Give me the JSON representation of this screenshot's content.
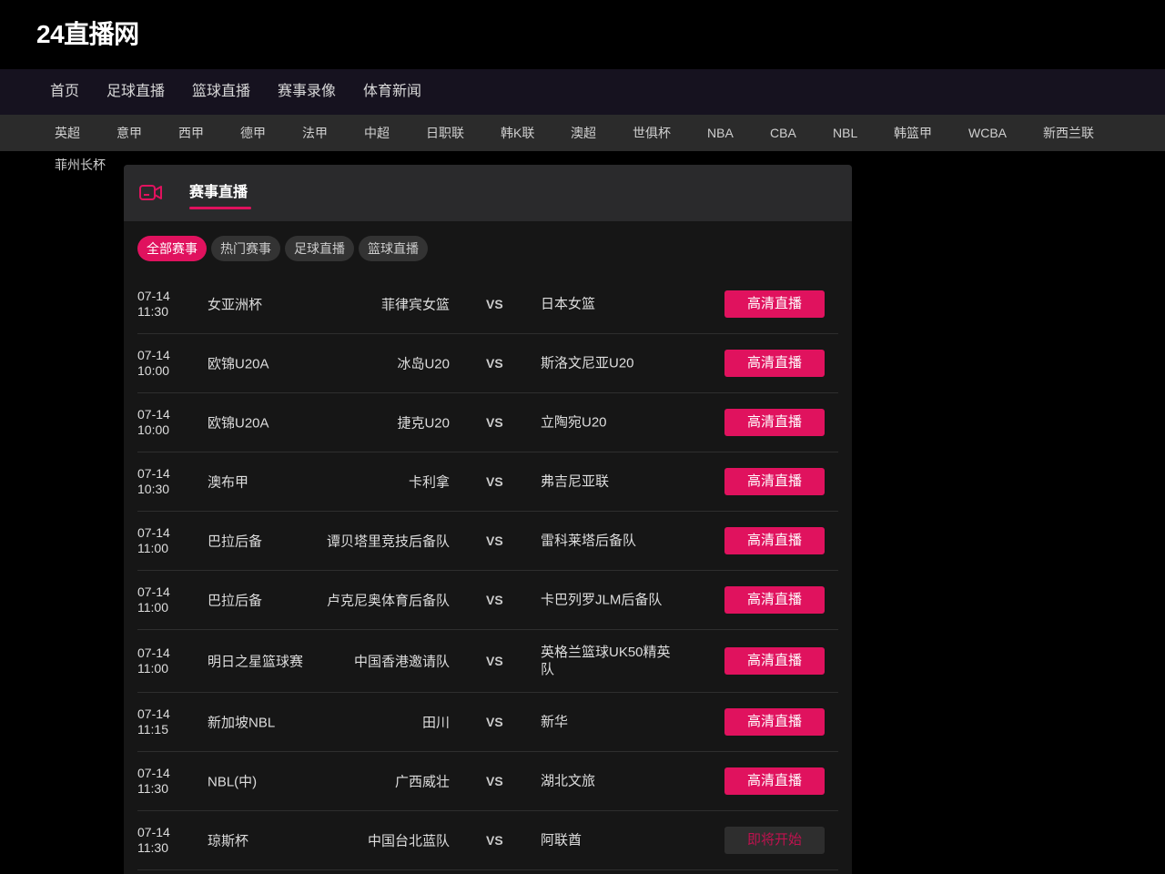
{
  "site": {
    "logo": "24直播网"
  },
  "main_nav": [
    "首页",
    "足球直播",
    "篮球直播",
    "赛事录像",
    "体育新闻"
  ],
  "sub_nav": [
    "英超",
    "意甲",
    "西甲",
    "德甲",
    "法甲",
    "中超",
    "日职联",
    "韩K联",
    "澳超",
    "世俱杯",
    "NBA",
    "CBA",
    "NBL",
    "韩篮甲",
    "WCBA",
    "新西兰联",
    "菲州长杯"
  ],
  "panel": {
    "title": "赛事直播",
    "filters": [
      "全部赛事",
      "热门赛事",
      "足球直播",
      "篮球直播"
    ],
    "active_filter": "全部赛事"
  },
  "colors": {
    "accent": "#e0125e",
    "nav_bg": "#16121f",
    "subnav_bg": "#2b2b2b",
    "panel_bg": "#161616"
  },
  "matches": [
    {
      "date": "07-14",
      "time": "11:30",
      "league": "女亚洲杯",
      "home": "菲律宾女篮",
      "vs": "VS",
      "away": "日本女篮",
      "action": "高清直播",
      "status": "live"
    },
    {
      "date": "07-14",
      "time": "10:00",
      "league": "欧锦U20A",
      "home": "冰岛U20",
      "vs": "VS",
      "away": "斯洛文尼亚U20",
      "action": "高清直播",
      "status": "live"
    },
    {
      "date": "07-14",
      "time": "10:00",
      "league": "欧锦U20A",
      "home": "捷克U20",
      "vs": "VS",
      "away": "立陶宛U20",
      "action": "高清直播",
      "status": "live"
    },
    {
      "date": "07-14",
      "time": "10:30",
      "league": "澳布甲",
      "home": "卡利拿",
      "vs": "VS",
      "away": "弗吉尼亚联",
      "action": "高清直播",
      "status": "live"
    },
    {
      "date": "07-14",
      "time": "11:00",
      "league": "巴拉后备",
      "home": "谭贝塔里竞技后备队",
      "vs": "VS",
      "away": "雷科莱塔后备队",
      "action": "高清直播",
      "status": "live"
    },
    {
      "date": "07-14",
      "time": "11:00",
      "league": "巴拉后备",
      "home": "卢克尼奥体育后备队",
      "vs": "VS",
      "away": "卡巴列罗JLM后备队",
      "action": "高清直播",
      "status": "live"
    },
    {
      "date": "07-14",
      "time": "11:00",
      "league": "明日之星篮球赛",
      "home": "中国香港邀请队",
      "vs": "VS",
      "away": "英格兰篮球UK50精英队",
      "action": "高清直播",
      "status": "live"
    },
    {
      "date": "07-14",
      "time": "11:15",
      "league": "新加坡NBL",
      "home": "田川",
      "vs": "VS",
      "away": "新华",
      "action": "高清直播",
      "status": "live"
    },
    {
      "date": "07-14",
      "time": "11:30",
      "league": "NBL(中)",
      "home": "广西威壮",
      "vs": "VS",
      "away": "湖北文旅",
      "action": "高清直播",
      "status": "live"
    },
    {
      "date": "07-14",
      "time": "11:30",
      "league": "琼斯杯",
      "home": "中国台北蓝队",
      "vs": "VS",
      "away": "阿联酋",
      "action": "即将开始",
      "status": "upcoming"
    }
  ]
}
